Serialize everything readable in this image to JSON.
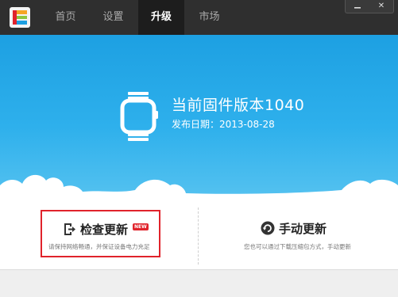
{
  "nav": {
    "tabs": [
      {
        "label": "首页"
      },
      {
        "label": "设置"
      },
      {
        "label": "升级"
      },
      {
        "label": "市场"
      }
    ],
    "active_index": 2
  },
  "window": {
    "minimize_icon": "minimize-icon",
    "close_icon": "close-icon",
    "close_glyph": "✕"
  },
  "firmware": {
    "title": "当前固件版本1040",
    "release_date": "发布日期：2013-08-28",
    "icon": "smartwatch-icon"
  },
  "actions": {
    "check_update": {
      "label": "检查更新",
      "badge": "NEW",
      "hint": "请保持网络畅通，并保证设备电力充足",
      "icon": "export-arrow-icon"
    },
    "manual_update": {
      "label": "手动更新",
      "hint": "您也可以通过下载压缩包方式，手动更新",
      "icon": "refresh-icon"
    }
  },
  "colors": {
    "titlebar": "#2f2f2f",
    "hero_top": "#1da0e2",
    "hero_bottom": "#57c3f0",
    "highlight_red": "#e0232b"
  }
}
